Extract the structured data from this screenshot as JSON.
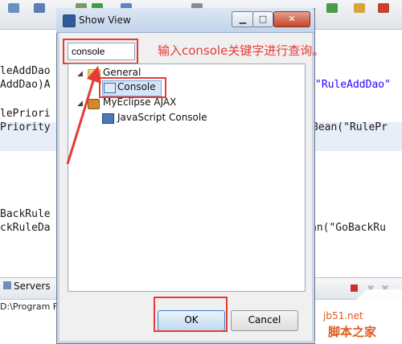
{
  "dialog": {
    "title": "Show View",
    "filter_value": "console",
    "ok_label": "OK",
    "cancel_label": "Cancel",
    "tree": {
      "general_label": "General",
      "console_label": "Console",
      "ajax_label": "MyEclipse AJAX",
      "js_console_label": "JavaScript Console"
    }
  },
  "annotation": "输入console关键字进行查询。",
  "editor": {
    "lines": [
      "leAddDao",
      "AddDao)A",
      "lePriori",
      "Priority",
      "BackRule",
      "ckRuleDa"
    ],
    "right_strings": [
      "\"RuleAddDao\"",
      "Bean(\"RulePr",
      "an(\"GoBackRu"
    ]
  },
  "bottom": {
    "servers_tab": "Servers",
    "path": "D:\\Program F"
  },
  "watermark": {
    "site": "jb51.net",
    "name": "脚本之家"
  },
  "colors": {
    "highlight_red": "#e53b35",
    "selection": "#d3e4fb"
  }
}
